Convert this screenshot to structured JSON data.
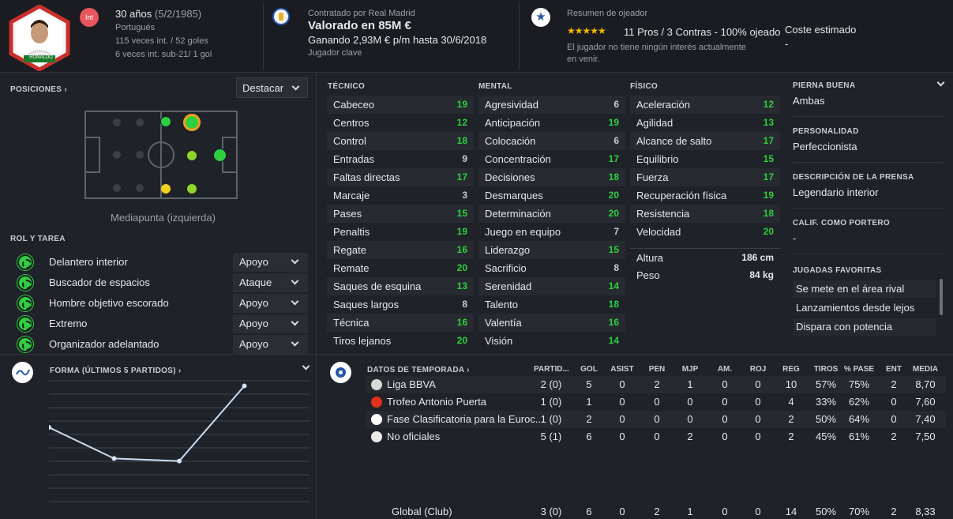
{
  "header": {
    "avatar_caption": "RONALDO",
    "int_badge": "Int",
    "age": "30 años",
    "dob": "(5/2/1985)",
    "nationality": "Portugués",
    "caps": "115 veces int. / 52 goles",
    "u21_caps": "6 veces int. sub-21/ 1 gol",
    "contract_label": "Contratado por Real Madrid",
    "value": "Valorado en 85M €",
    "wage": "Ganando 2,93M € p/m hasta 30/6/2018",
    "squad_status": "Jugador clave",
    "scout_label": "Resumen de ojeador",
    "stars": "★★★★★",
    "scout_summary": "11 Pros / 3 Contras - 100% ojeado",
    "interest": "El jugador no tiene ningún interés actualmente en venir.",
    "est_cost_label": "Coste estimado",
    "est_cost_value": "-"
  },
  "positions": {
    "title": "POSICIONES",
    "highlight_dropdown": "Destacar",
    "caption": "Mediapunta (izquierda)"
  },
  "roles": {
    "title": "ROL Y TAREA",
    "items": [
      {
        "name": "Delantero interior",
        "duty": "Apoyo"
      },
      {
        "name": "Buscador de espacios",
        "duty": "Ataque"
      },
      {
        "name": "Hombre objetivo escorado",
        "duty": "Apoyo"
      },
      {
        "name": "Extremo",
        "duty": "Apoyo"
      },
      {
        "name": "Organizador adelantado",
        "duty": "Apoyo"
      }
    ]
  },
  "attributes": {
    "technical_title": "TÉCNICO",
    "mental_title": "MENTAL",
    "physical_title": "FÍSICO",
    "technical": [
      {
        "name": "Cabeceo",
        "value": "19"
      },
      {
        "name": "Centros",
        "value": "12"
      },
      {
        "name": "Control",
        "value": "18"
      },
      {
        "name": "Entradas",
        "value": "9"
      },
      {
        "name": "Faltas directas",
        "value": "17"
      },
      {
        "name": "Marcaje",
        "value": "3"
      },
      {
        "name": "Pases",
        "value": "15"
      },
      {
        "name": "Penaltis",
        "value": "19"
      },
      {
        "name": "Regate",
        "value": "16"
      },
      {
        "name": "Remate",
        "value": "20"
      },
      {
        "name": "Saques de esquina",
        "value": "13"
      },
      {
        "name": "Saques largos",
        "value": "8"
      },
      {
        "name": "Técnica",
        "value": "16"
      },
      {
        "name": "Tiros lejanos",
        "value": "20"
      }
    ],
    "mental": [
      {
        "name": "Agresividad",
        "value": "6"
      },
      {
        "name": "Anticipación",
        "value": "19"
      },
      {
        "name": "Colocación",
        "value": "6"
      },
      {
        "name": "Concentración",
        "value": "17"
      },
      {
        "name": "Decisiones",
        "value": "18"
      },
      {
        "name": "Desmarques",
        "value": "20"
      },
      {
        "name": "Determinación",
        "value": "20"
      },
      {
        "name": "Juego en equipo",
        "value": "7"
      },
      {
        "name": "Liderazgo",
        "value": "15"
      },
      {
        "name": "Sacrificio",
        "value": "8"
      },
      {
        "name": "Serenidad",
        "value": "14"
      },
      {
        "name": "Talento",
        "value": "18"
      },
      {
        "name": "Valentía",
        "value": "16"
      },
      {
        "name": "Visión",
        "value": "14"
      }
    ],
    "physical": [
      {
        "name": "Aceleración",
        "value": "12"
      },
      {
        "name": "Agilidad",
        "value": "13"
      },
      {
        "name": "Alcance de salto",
        "value": "17"
      },
      {
        "name": "Equilibrio",
        "value": "15"
      },
      {
        "name": "Fuerza",
        "value": "17"
      },
      {
        "name": "Recuperación física",
        "value": "19"
      },
      {
        "name": "Resistencia",
        "value": "18"
      },
      {
        "name": "Velocidad",
        "value": "20"
      }
    ],
    "height_label": "Altura",
    "height_value": "186 cm",
    "weight_label": "Peso",
    "weight_value": "84 kg"
  },
  "profile": {
    "foot_label": "PIERNA BUENA",
    "foot_value": "Ambas",
    "personality_label": "PERSONALIDAD",
    "personality_value": "Perfeccionista",
    "press_label": "DESCRIPCIÓN DE LA PRENSA",
    "press_value": "Legendario interior",
    "gk_label": "CALIF. COMO PORTERO",
    "gk_value": "-",
    "traits_label": "JUGADAS FAVORITAS",
    "traits": [
      "Se mete en el área rival",
      "Lanzamientos desde lejos",
      "Dispara con potencia"
    ]
  },
  "form": {
    "title": "FORMA (ÚLTIMOS 5 PARTIDOS)"
  },
  "chart_data": {
    "type": "line",
    "title": "",
    "x": [
      1,
      2,
      3,
      4
    ],
    "values": [
      7.6,
      7.0,
      6.95,
      8.4
    ],
    "ylim": [
      6.0,
      8.5
    ],
    "grid": true
  },
  "season": {
    "title": "DATOS DE TEMPORADA",
    "columns": [
      "PARTID...",
      "GOL",
      "ASIST",
      "PEN",
      "MJP",
      "AM.",
      "ROJ",
      "REG",
      "TIROS",
      "% PASE",
      "ENT",
      "MEDIA"
    ],
    "rows": [
      {
        "comp": "Liga BBVA",
        "icon_color": "#d9d9d9",
        "cells": [
          "2 (0)",
          "5",
          "0",
          "2",
          "1",
          "0",
          "0",
          "10",
          "57%",
          "75%",
          "2",
          "8,70"
        ]
      },
      {
        "comp": "Trofeo Antonio Puerta",
        "icon_color": "#e0301e",
        "cells": [
          "1 (0)",
          "1",
          "0",
          "0",
          "0",
          "0",
          "0",
          "4",
          "33%",
          "62%",
          "0",
          "7,60"
        ]
      },
      {
        "comp": "Fase Clasificatoria para la Euroc...",
        "icon_color": "#ffffff",
        "cells": [
          "1 (0)",
          "2",
          "0",
          "0",
          "0",
          "0",
          "0",
          "2",
          "50%",
          "64%",
          "0",
          "7,40"
        ]
      },
      {
        "comp": "No oficiales",
        "icon_color": "#e9e9e9",
        "cells": [
          "5 (1)",
          "6",
          "0",
          "0",
          "2",
          "0",
          "0",
          "2",
          "45%",
          "61%",
          "2",
          "7,50"
        ]
      }
    ],
    "total": {
      "comp": "Global (Club)",
      "cells": [
        "3 (0)",
        "6",
        "0",
        "2",
        "1",
        "0",
        "0",
        "14",
        "50%",
        "70%",
        "2",
        "8,33"
      ]
    }
  }
}
